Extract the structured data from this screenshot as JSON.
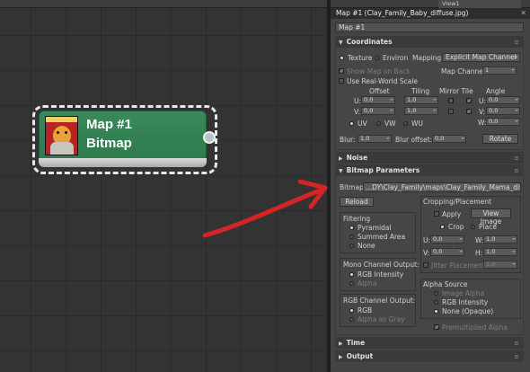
{
  "viewport": {
    "tab": "View1"
  },
  "node": {
    "title": "Map #1",
    "type": "Bitmap"
  },
  "panel": {
    "title": "Map #1 (Clay_Family_Baby_diffuse.jpg)",
    "name_value": "Map #1",
    "coords": {
      "header": "Coordinates",
      "texture": "Texture",
      "environ": "Environ",
      "mapping_label": "Mapping:",
      "mapping_value": "Explicit Map Channel",
      "show_map": "Show Map on Back",
      "map_channel_label": "Map Channel:",
      "map_channel_value": "1",
      "real_world": "Use Real-World Scale",
      "col_offset": "Offset",
      "col_tiling": "Tiling",
      "col_mirror": "Mirror Tile",
      "col_angle": "Angle",
      "u_label": "U:",
      "v_label": "V:",
      "w_label": "W:",
      "u_offset": "0,0",
      "v_offset": "0,0",
      "u_tiling": "1,0",
      "v_tiling": "1,0",
      "u_angle": "0,0",
      "v_angle": "0,0",
      "w_angle": "0,0",
      "uv": "UV",
      "vw": "VW",
      "wu": "WU",
      "blur_label": "Blur:",
      "blur_value": "1,0",
      "blur_offset_label": "Blur offset:",
      "blur_offset_value": "0,0",
      "rotate": "Rotate"
    },
    "noise_header": "Noise",
    "bitmap": {
      "header": "Bitmap Parameters",
      "label": "Bitmap:",
      "path": "...DY\\Clay_Family\\maps\\Clay_Family_Mama_diffuse.jpg",
      "reload": "Reload",
      "filtering": "Filtering",
      "pyramidal": "Pyramidal",
      "summed": "Summed Area",
      "none": "None",
      "mono": "Mono Channel Output:",
      "rgb_intensity": "RGB Intensity",
      "alpha": "Alpha",
      "rgb_out": "RGB Channel Output:",
      "rgb": "RGB",
      "alpha_gray": "Alpha as Gray",
      "crop_group": "Cropping/Placement",
      "apply": "Apply",
      "view_image": "View Image",
      "crop": "Crop",
      "place": "Place",
      "u_val": "0,0",
      "w_lbl": "W:",
      "w_val": "1,0",
      "v_val": "0,0",
      "h_lbl": "H:",
      "h_val": "1,0",
      "jitter": "Jitter Placement:",
      "jitter_val": "1,0",
      "alpha_src": "Alpha Source",
      "image_alpha": "Image Alpha",
      "as_rgb": "RGB Intensity",
      "none_opaque": "None (Opaque)",
      "premult": "Premultiplied Alpha"
    },
    "time_header": "Time",
    "output_header": "Output"
  },
  "colors": {
    "node": "#2e7a4c",
    "arrow": "#d42424",
    "panel": "#444444"
  }
}
